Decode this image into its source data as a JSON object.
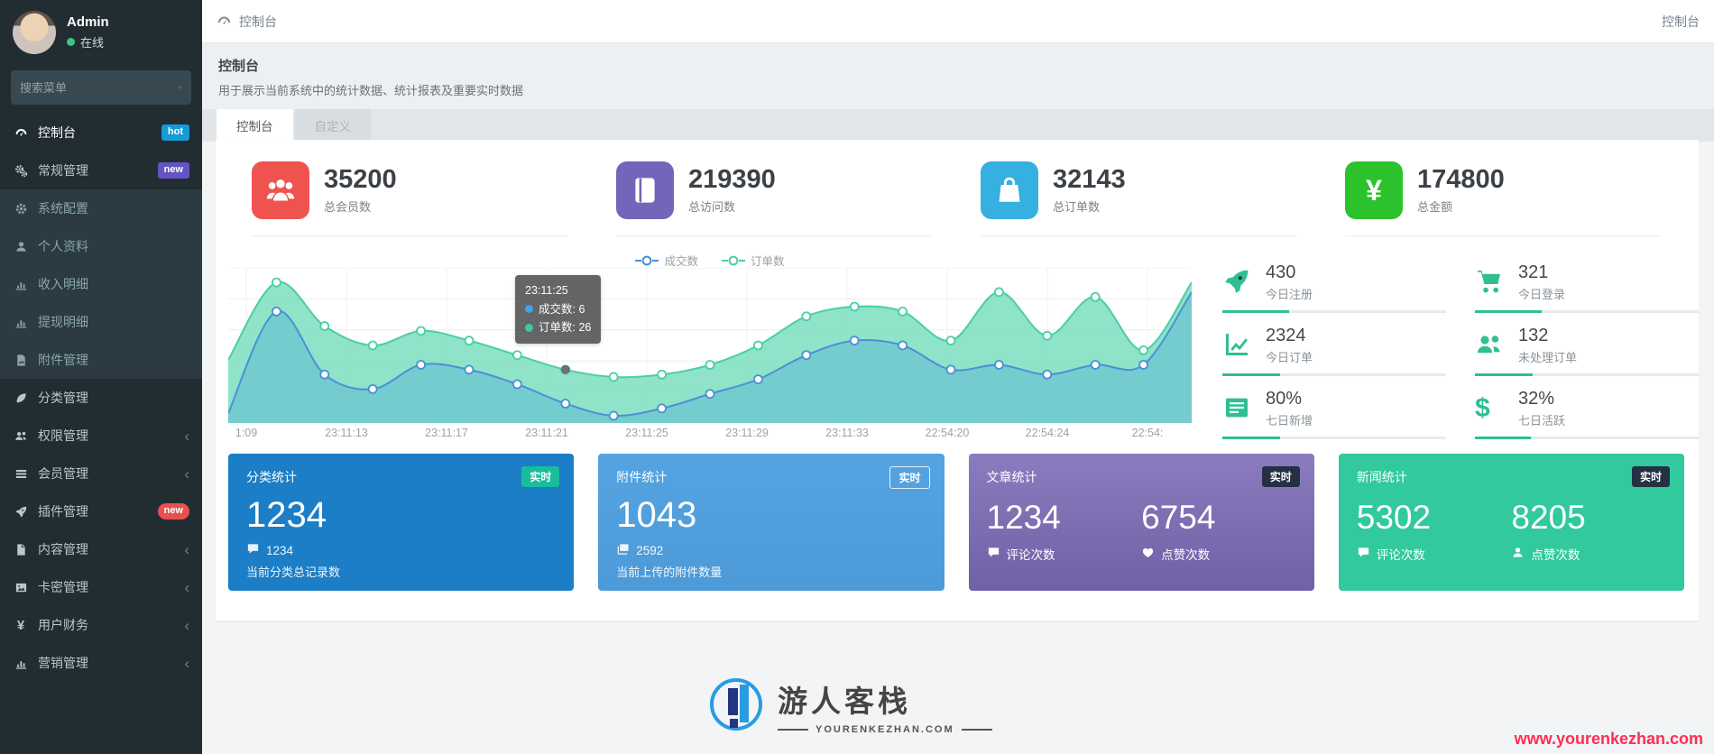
{
  "app": {
    "breadcrumb": "控制台",
    "topbar_right": "控制台"
  },
  "sidebar": {
    "user": {
      "name": "Admin",
      "status": "在线"
    },
    "search_placeholder": "搜索菜单",
    "items": [
      {
        "icon": "tachometer-icon",
        "label": "控制台",
        "badge": "hot",
        "badge_color": "#169bd5",
        "active": true
      },
      {
        "icon": "gears-icon",
        "label": "常规管理",
        "badge": "new",
        "badge_color": "#6454c3"
      },
      {
        "icon": "gear-icon",
        "label": "系统配置",
        "submenu": true
      },
      {
        "icon": "user-icon",
        "label": "个人资料",
        "submenu": true
      },
      {
        "icon": "bar-chart-icon",
        "label": "收入明细",
        "submenu": true
      },
      {
        "icon": "bar-chart-icon",
        "label": "提现明细",
        "submenu": true
      },
      {
        "icon": "file-image-icon",
        "label": "附件管理",
        "submenu": true
      },
      {
        "icon": "leaf-icon",
        "label": "分类管理"
      },
      {
        "icon": "users-icon",
        "label": "权限管理",
        "chevron": true
      },
      {
        "icon": "list-icon",
        "label": "会员管理",
        "chevron": true
      },
      {
        "icon": "rocket-icon",
        "label": "插件管理",
        "badge": "new",
        "badge_color": "#e8504f",
        "badge_pill": true
      },
      {
        "icon": "file-icon",
        "label": "内容管理",
        "chevron": true
      },
      {
        "icon": "image-icon",
        "label": "卡密管理",
        "chevron": true
      },
      {
        "icon": "yen-icon",
        "label": "用户财务",
        "chevron": true
      },
      {
        "icon": "bar-chart-icon",
        "label": "营销管理",
        "chevron": true
      }
    ]
  },
  "page_header": {
    "title": "控制台",
    "description": "用于展示当前系统中的统计数据、统计报表及重要实时数据"
  },
  "tabs": [
    {
      "label": "控制台",
      "active": true
    },
    {
      "label": "自定义",
      "active": false
    }
  ],
  "stats": [
    {
      "icon": "users-group-icon",
      "color": "#ef5350",
      "value": "35200",
      "label": "总会员数"
    },
    {
      "icon": "book-icon",
      "color": "#7266ba",
      "value": "219390",
      "label": "总访问数"
    },
    {
      "icon": "shopping-bag-icon",
      "color": "#35b0e0",
      "value": "32143",
      "label": "总订单数"
    },
    {
      "icon": "yen-glyph-icon",
      "color": "#2cc22c",
      "value": "174800",
      "label": "总金额"
    }
  ],
  "chart_data": {
    "type": "area",
    "x_ticks": [
      "1:09",
      "23:11:13",
      "23:11:17",
      "23:11:21",
      "23:11:25",
      "23:11:29",
      "23:11:33",
      "22:54:20",
      "22:54:24",
      "22:54:"
    ],
    "series": [
      {
        "name": "成交数",
        "color": "#4a90d5",
        "fill": "rgba(87,176,216,0.45)",
        "values": [
          2,
          23,
          10,
          7,
          12,
          11,
          8,
          4,
          1.5,
          3,
          6,
          9,
          14,
          17,
          16,
          11,
          12,
          10,
          12,
          12,
          27
        ]
      },
      {
        "name": "订单数",
        "color": "#49cfa6",
        "fill": "rgba(130,224,195,0.9)",
        "values": [
          13,
          29,
          20,
          16,
          19,
          17,
          14,
          11,
          9.5,
          10,
          12,
          16,
          22,
          24,
          23,
          17,
          27,
          18,
          26,
          15,
          29
        ]
      }
    ],
    "ylim": [
      0,
      32
    ],
    "grid": true,
    "legend_position": "top-center",
    "tooltip": {
      "title": "23:11:25",
      "rows": [
        {
          "name": "成交数",
          "value": "6",
          "color": "#45a3e5"
        },
        {
          "name": "订单数",
          "value": "26",
          "color": "#3cc9a0"
        }
      ]
    }
  },
  "side_stats": [
    {
      "icon": "rocket-icon",
      "value": "430",
      "label": "今日注册",
      "progress": 30
    },
    {
      "icon": "cart-icon",
      "value": "321",
      "label": "今日登录",
      "progress": 30
    },
    {
      "icon": "line-chart-icon",
      "value": "2324",
      "label": "今日订单",
      "progress": 26
    },
    {
      "icon": "users-icon",
      "value": "132",
      "label": "未处理订单",
      "progress": 26
    },
    {
      "icon": "table-icon",
      "value": "80%",
      "label": "七日新增",
      "progress": 26
    },
    {
      "icon": "dollar-glyph-icon",
      "value": "32%",
      "label": "七日活跃",
      "progress": 25
    }
  ],
  "bottom_cards": [
    {
      "title": "分类统计",
      "badge": "实时",
      "badge_style": "green",
      "style": "blue",
      "big_value": "1234",
      "meta_icon": "comment-icon",
      "meta": "1234",
      "caption": "当前分类总记录数"
    },
    {
      "title": "附件统计",
      "badge": "实时",
      "badge_style": "outline",
      "style": "lightblue",
      "big_value": "1043",
      "meta_icon": "images-icon",
      "meta": "2592",
      "caption": "当前上传的附件数量"
    },
    {
      "title": "文章统计",
      "badge": "实时",
      "badge_style": "dark",
      "style": "purple",
      "pairs": [
        {
          "value": "1234",
          "icon": "comment-icon",
          "label": "评论次数"
        },
        {
          "value": "6754",
          "icon": "heart-icon",
          "label": "点赞次数"
        }
      ]
    },
    {
      "title": "新闻统计",
      "badge": "实时",
      "badge_style": "dark",
      "style": "green",
      "pairs": [
        {
          "value": "5302",
          "icon": "comment-icon",
          "label": "评论次数"
        },
        {
          "value": "8205",
          "icon": "person-icon",
          "label": "点赞次数"
        }
      ]
    }
  ],
  "footer": {
    "logo_text": "游人客栈",
    "logo_sub": "YOURENKEZHAN.COM",
    "site_url": "www.yourenkezhan.com"
  }
}
